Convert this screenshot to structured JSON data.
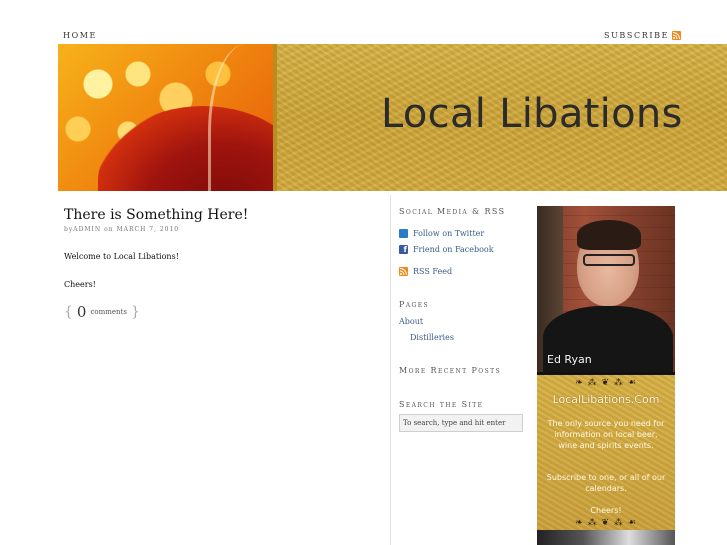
{
  "topnav": {
    "home": "HOME",
    "subscribe": "SUBSCRIBE"
  },
  "header": {
    "site_title": "Local Libations"
  },
  "post": {
    "title": "There is Something Here!",
    "meta_by": "by",
    "meta_author": "ADMIN",
    "meta_on": "on",
    "meta_date": "MARCH 7, 2010",
    "body": [
      "Welcome to Local Libations!",
      "Cheers!"
    ],
    "comments_count": "0",
    "comments_label": "comments",
    "brace_open": "{",
    "brace_close": "}"
  },
  "sidebar": {
    "social_title": "Social Media & RSS",
    "twitter": "Follow on Twitter",
    "facebook": "Friend on Facebook",
    "rss": "RSS Feed",
    "pages_title": "Pages",
    "pages": [
      "About",
      "Distilleries"
    ],
    "recent_title": "More Recent Posts",
    "search_title": "Search the Site",
    "search_placeholder": "To search, type and hit enter"
  },
  "ad": {
    "name": "Ed Ryan",
    "site": "LocalLibations.Com",
    "flourish": "❧ ⁂ ❦ ⁂ ☙",
    "text1": "The only source you need for information on local beer, wine and spirits events.",
    "text2": "Subscribe to one, or all of our calendars.",
    "text3": "Cheers!"
  },
  "colors": {
    "link": "#3a5a8a",
    "banner_gold": "#cfa635",
    "rss_orange": "#f08a1c"
  }
}
